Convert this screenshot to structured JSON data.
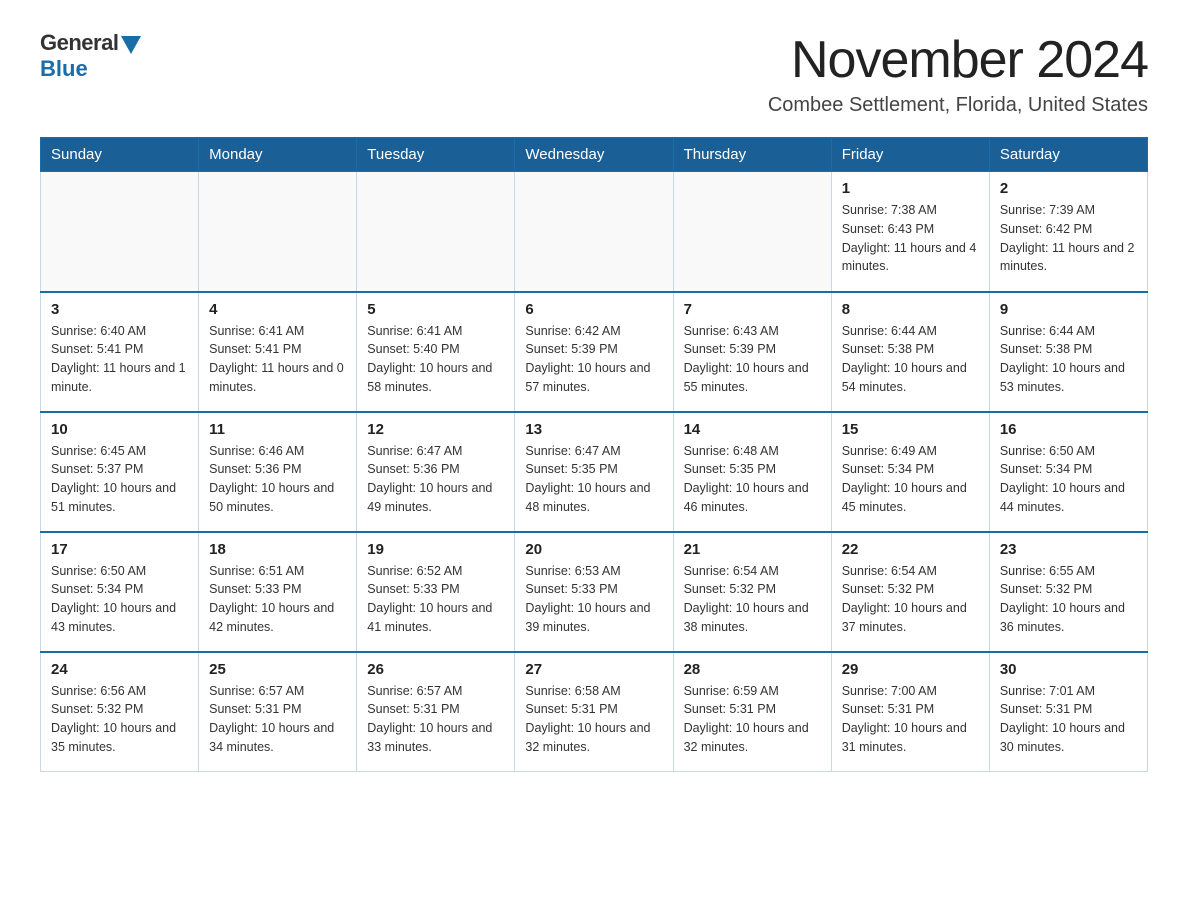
{
  "header": {
    "logo_general": "General",
    "logo_blue": "Blue",
    "month_title": "November 2024",
    "location": "Combee Settlement, Florida, United States"
  },
  "days_of_week": [
    "Sunday",
    "Monday",
    "Tuesday",
    "Wednesday",
    "Thursday",
    "Friday",
    "Saturday"
  ],
  "weeks": [
    [
      {
        "day": "",
        "info": ""
      },
      {
        "day": "",
        "info": ""
      },
      {
        "day": "",
        "info": ""
      },
      {
        "day": "",
        "info": ""
      },
      {
        "day": "",
        "info": ""
      },
      {
        "day": "1",
        "info": "Sunrise: 7:38 AM\nSunset: 6:43 PM\nDaylight: 11 hours and 4 minutes."
      },
      {
        "day": "2",
        "info": "Sunrise: 7:39 AM\nSunset: 6:42 PM\nDaylight: 11 hours and 2 minutes."
      }
    ],
    [
      {
        "day": "3",
        "info": "Sunrise: 6:40 AM\nSunset: 5:41 PM\nDaylight: 11 hours and 1 minute."
      },
      {
        "day": "4",
        "info": "Sunrise: 6:41 AM\nSunset: 5:41 PM\nDaylight: 11 hours and 0 minutes."
      },
      {
        "day": "5",
        "info": "Sunrise: 6:41 AM\nSunset: 5:40 PM\nDaylight: 10 hours and 58 minutes."
      },
      {
        "day": "6",
        "info": "Sunrise: 6:42 AM\nSunset: 5:39 PM\nDaylight: 10 hours and 57 minutes."
      },
      {
        "day": "7",
        "info": "Sunrise: 6:43 AM\nSunset: 5:39 PM\nDaylight: 10 hours and 55 minutes."
      },
      {
        "day": "8",
        "info": "Sunrise: 6:44 AM\nSunset: 5:38 PM\nDaylight: 10 hours and 54 minutes."
      },
      {
        "day": "9",
        "info": "Sunrise: 6:44 AM\nSunset: 5:38 PM\nDaylight: 10 hours and 53 minutes."
      }
    ],
    [
      {
        "day": "10",
        "info": "Sunrise: 6:45 AM\nSunset: 5:37 PM\nDaylight: 10 hours and 51 minutes."
      },
      {
        "day": "11",
        "info": "Sunrise: 6:46 AM\nSunset: 5:36 PM\nDaylight: 10 hours and 50 minutes."
      },
      {
        "day": "12",
        "info": "Sunrise: 6:47 AM\nSunset: 5:36 PM\nDaylight: 10 hours and 49 minutes."
      },
      {
        "day": "13",
        "info": "Sunrise: 6:47 AM\nSunset: 5:35 PM\nDaylight: 10 hours and 48 minutes."
      },
      {
        "day": "14",
        "info": "Sunrise: 6:48 AM\nSunset: 5:35 PM\nDaylight: 10 hours and 46 minutes."
      },
      {
        "day": "15",
        "info": "Sunrise: 6:49 AM\nSunset: 5:34 PM\nDaylight: 10 hours and 45 minutes."
      },
      {
        "day": "16",
        "info": "Sunrise: 6:50 AM\nSunset: 5:34 PM\nDaylight: 10 hours and 44 minutes."
      }
    ],
    [
      {
        "day": "17",
        "info": "Sunrise: 6:50 AM\nSunset: 5:34 PM\nDaylight: 10 hours and 43 minutes."
      },
      {
        "day": "18",
        "info": "Sunrise: 6:51 AM\nSunset: 5:33 PM\nDaylight: 10 hours and 42 minutes."
      },
      {
        "day": "19",
        "info": "Sunrise: 6:52 AM\nSunset: 5:33 PM\nDaylight: 10 hours and 41 minutes."
      },
      {
        "day": "20",
        "info": "Sunrise: 6:53 AM\nSunset: 5:33 PM\nDaylight: 10 hours and 39 minutes."
      },
      {
        "day": "21",
        "info": "Sunrise: 6:54 AM\nSunset: 5:32 PM\nDaylight: 10 hours and 38 minutes."
      },
      {
        "day": "22",
        "info": "Sunrise: 6:54 AM\nSunset: 5:32 PM\nDaylight: 10 hours and 37 minutes."
      },
      {
        "day": "23",
        "info": "Sunrise: 6:55 AM\nSunset: 5:32 PM\nDaylight: 10 hours and 36 minutes."
      }
    ],
    [
      {
        "day": "24",
        "info": "Sunrise: 6:56 AM\nSunset: 5:32 PM\nDaylight: 10 hours and 35 minutes."
      },
      {
        "day": "25",
        "info": "Sunrise: 6:57 AM\nSunset: 5:31 PM\nDaylight: 10 hours and 34 minutes."
      },
      {
        "day": "26",
        "info": "Sunrise: 6:57 AM\nSunset: 5:31 PM\nDaylight: 10 hours and 33 minutes."
      },
      {
        "day": "27",
        "info": "Sunrise: 6:58 AM\nSunset: 5:31 PM\nDaylight: 10 hours and 32 minutes."
      },
      {
        "day": "28",
        "info": "Sunrise: 6:59 AM\nSunset: 5:31 PM\nDaylight: 10 hours and 32 minutes."
      },
      {
        "day": "29",
        "info": "Sunrise: 7:00 AM\nSunset: 5:31 PM\nDaylight: 10 hours and 31 minutes."
      },
      {
        "day": "30",
        "info": "Sunrise: 7:01 AM\nSunset: 5:31 PM\nDaylight: 10 hours and 30 minutes."
      }
    ]
  ]
}
